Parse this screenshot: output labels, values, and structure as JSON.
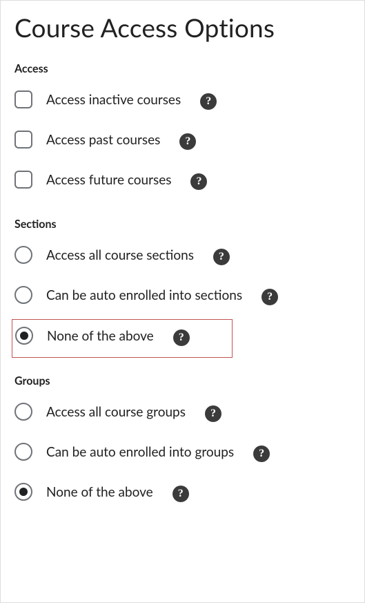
{
  "title": "Course Access Options",
  "access": {
    "heading": "Access",
    "items": [
      {
        "label": "Access inactive courses",
        "checked": false
      },
      {
        "label": "Access past courses",
        "checked": false
      },
      {
        "label": "Access future courses",
        "checked": false
      }
    ]
  },
  "sections": {
    "heading": "Sections",
    "items": [
      {
        "label": "Access all course sections",
        "selected": false
      },
      {
        "label": "Can be auto enrolled into sections",
        "selected": false
      },
      {
        "label": "None of the above",
        "selected": true,
        "highlighted": true
      }
    ]
  },
  "groups": {
    "heading": "Groups",
    "items": [
      {
        "label": "Access all course groups",
        "selected": false
      },
      {
        "label": "Can be auto enrolled into groups",
        "selected": false
      },
      {
        "label": "None of the above",
        "selected": true
      }
    ]
  },
  "help_glyph": "?"
}
